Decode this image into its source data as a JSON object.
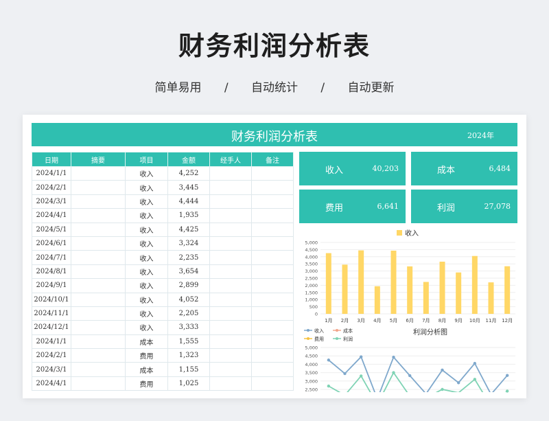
{
  "hero": {
    "title": "财务利润分析表",
    "features": [
      "简单易用",
      "自动统计",
      "自动更新"
    ],
    "separator": "/"
  },
  "banner": {
    "title": "财务利润分析表",
    "year": "2024年"
  },
  "table": {
    "headers": [
      "日期",
      "摘要",
      "项目",
      "金额",
      "经手人",
      "备注"
    ],
    "rows": [
      [
        "2024/1/1",
        "",
        "收入",
        "4,252",
        "",
        ""
      ],
      [
        "2024/2/1",
        "",
        "收入",
        "3,445",
        "",
        ""
      ],
      [
        "2024/3/1",
        "",
        "收入",
        "4,444",
        "",
        ""
      ],
      [
        "2024/4/1",
        "",
        "收入",
        "1,935",
        "",
        ""
      ],
      [
        "2024/5/1",
        "",
        "收入",
        "4,425",
        "",
        ""
      ],
      [
        "2024/6/1",
        "",
        "收入",
        "3,324",
        "",
        ""
      ],
      [
        "2024/7/1",
        "",
        "收入",
        "2,235",
        "",
        ""
      ],
      [
        "2024/8/1",
        "",
        "收入",
        "3,654",
        "",
        ""
      ],
      [
        "2024/9/1",
        "",
        "收入",
        "2,899",
        "",
        ""
      ],
      [
        "2024/10/1",
        "",
        "收入",
        "4,052",
        "",
        ""
      ],
      [
        "2024/11/1",
        "",
        "收入",
        "2,205",
        "",
        ""
      ],
      [
        "2024/12/1",
        "",
        "收入",
        "3,333",
        "",
        ""
      ],
      [
        "2024/1/1",
        "",
        "成本",
        "1,555",
        "",
        ""
      ],
      [
        "2024/2/1",
        "",
        "费用",
        "1,323",
        "",
        ""
      ],
      [
        "2024/3/1",
        "",
        "成本",
        "1,155",
        "",
        ""
      ],
      [
        "2024/4/1",
        "",
        "费用",
        "1,025",
        "",
        ""
      ]
    ]
  },
  "kpis": [
    {
      "label": "收入",
      "value": "40,203"
    },
    {
      "label": "成本",
      "value": "6,484"
    },
    {
      "label": "费用",
      "value": "6,641"
    },
    {
      "label": "利润",
      "value": "27,078"
    }
  ],
  "colors": {
    "accent": "#2fbfb0",
    "income": "#ffd766",
    "income_line": "#7fa8cc",
    "cost": "#f2a58b",
    "expense": "#f5c242",
    "profit": "#7fd3b4"
  },
  "chart_data": [
    {
      "type": "bar",
      "title": "",
      "categories": [
        "1月",
        "2月",
        "3月",
        "4月",
        "5月",
        "6月",
        "7月",
        "8月",
        "9月",
        "10月",
        "11月",
        "12月"
      ],
      "series": [
        {
          "name": "收入",
          "values": [
            4252,
            3445,
            4444,
            1935,
            4425,
            3324,
            2235,
            3654,
            2899,
            4052,
            2205,
            3333
          ]
        }
      ],
      "yticks": [
        "0",
        "500",
        "1,000",
        "1,500",
        "2,000",
        "2,500",
        "3,000",
        "3,500",
        "4,000",
        "4,500",
        "5,000"
      ],
      "ylim": [
        0,
        5000
      ],
      "legend": "top",
      "grid": true
    },
    {
      "type": "line",
      "title": "利润分析图",
      "legend": "top-left",
      "yticks": [
        "2,500",
        "3,000",
        "3,500",
        "4,000",
        "4,500",
        "5,000"
      ],
      "ylim": [
        2500,
        5000
      ],
      "series": [
        {
          "name": "收入",
          "values": [
            4252,
            3445,
            4444,
            1935,
            4425,
            3324,
            2235,
            3654,
            2899,
            4052,
            2205,
            3333
          ]
        },
        {
          "name": "成本",
          "values": []
        },
        {
          "name": "费用",
          "values": []
        },
        {
          "name": "利润",
          "values": [
            2700,
            2150,
            3300,
            1600,
            3500,
            2100,
            2000,
            2500,
            2300,
            3100,
            1500,
            2400
          ]
        }
      ]
    }
  ]
}
